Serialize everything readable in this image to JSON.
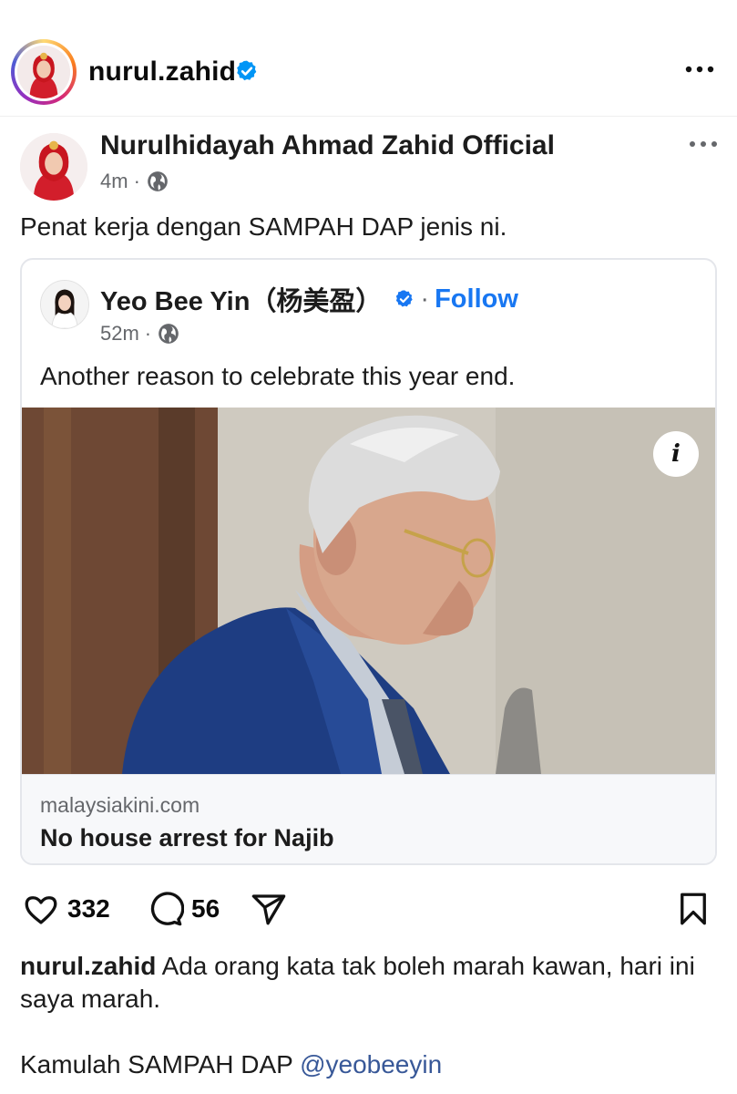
{
  "instagram": {
    "username": "nurul.zahid",
    "verified_icon": "verified-badge-icon",
    "more_icon": "more-horizontal-icon"
  },
  "facebook_post": {
    "author": "Nurulhidayah Ahmad Zahid Official",
    "time": "4m",
    "separator": "·",
    "privacy_icon": "globe-icon",
    "text": "Penat kerja dengan SAMPAH DAP jenis ni.",
    "shared_post": {
      "author": "Yeo Bee Yin（杨美盈）",
      "separator": "·",
      "follow_label": "Follow",
      "time": "52m",
      "text": "Another reason to celebrate this year end.",
      "info_label": "i",
      "link": {
        "domain": "malaysiakini.com",
        "title": "No house arrest for Najib"
      }
    }
  },
  "actions": {
    "likes": "332",
    "comments": "56"
  },
  "caption": {
    "username": "nurul.zahid",
    "text": "Ada orang kata tak boleh marah kawan, hari ini saya marah.",
    "line2_text": "Kamulah SAMPAH DAP",
    "mention": "@yeobeeyin"
  },
  "colors": {
    "fb_blue": "#1877f2",
    "ig_verified": "#0095f6",
    "mention": "#385898",
    "muted": "#65676b"
  }
}
